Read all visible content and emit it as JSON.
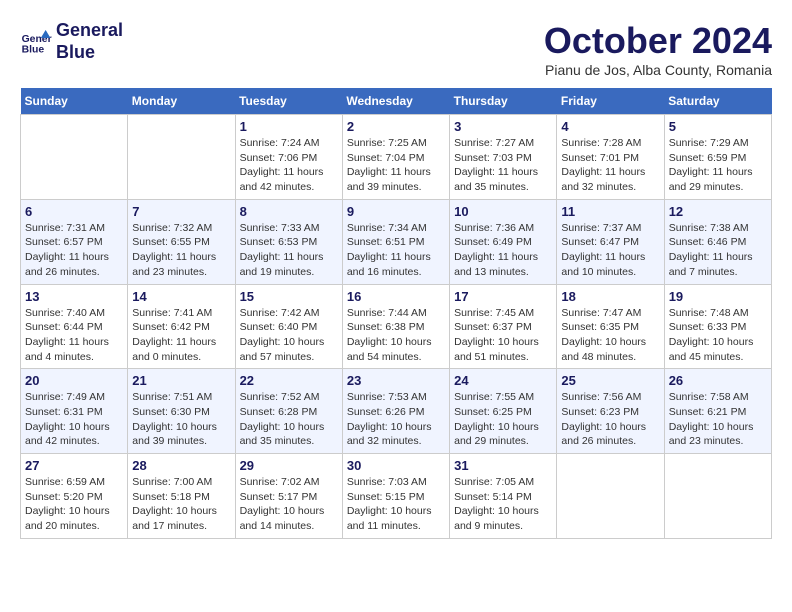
{
  "header": {
    "logo_line1": "General",
    "logo_line2": "Blue",
    "month": "October 2024",
    "location": "Pianu de Jos, Alba County, Romania"
  },
  "weekdays": [
    "Sunday",
    "Monday",
    "Tuesday",
    "Wednesday",
    "Thursday",
    "Friday",
    "Saturday"
  ],
  "weeks": [
    [
      {
        "day": "",
        "info": ""
      },
      {
        "day": "",
        "info": ""
      },
      {
        "day": "1",
        "info": "Sunrise: 7:24 AM\nSunset: 7:06 PM\nDaylight: 11 hours and 42 minutes."
      },
      {
        "day": "2",
        "info": "Sunrise: 7:25 AM\nSunset: 7:04 PM\nDaylight: 11 hours and 39 minutes."
      },
      {
        "day": "3",
        "info": "Sunrise: 7:27 AM\nSunset: 7:03 PM\nDaylight: 11 hours and 35 minutes."
      },
      {
        "day": "4",
        "info": "Sunrise: 7:28 AM\nSunset: 7:01 PM\nDaylight: 11 hours and 32 minutes."
      },
      {
        "day": "5",
        "info": "Sunrise: 7:29 AM\nSunset: 6:59 PM\nDaylight: 11 hours and 29 minutes."
      }
    ],
    [
      {
        "day": "6",
        "info": "Sunrise: 7:31 AM\nSunset: 6:57 PM\nDaylight: 11 hours and 26 minutes."
      },
      {
        "day": "7",
        "info": "Sunrise: 7:32 AM\nSunset: 6:55 PM\nDaylight: 11 hours and 23 minutes."
      },
      {
        "day": "8",
        "info": "Sunrise: 7:33 AM\nSunset: 6:53 PM\nDaylight: 11 hours and 19 minutes."
      },
      {
        "day": "9",
        "info": "Sunrise: 7:34 AM\nSunset: 6:51 PM\nDaylight: 11 hours and 16 minutes."
      },
      {
        "day": "10",
        "info": "Sunrise: 7:36 AM\nSunset: 6:49 PM\nDaylight: 11 hours and 13 minutes."
      },
      {
        "day": "11",
        "info": "Sunrise: 7:37 AM\nSunset: 6:47 PM\nDaylight: 11 hours and 10 minutes."
      },
      {
        "day": "12",
        "info": "Sunrise: 7:38 AM\nSunset: 6:46 PM\nDaylight: 11 hours and 7 minutes."
      }
    ],
    [
      {
        "day": "13",
        "info": "Sunrise: 7:40 AM\nSunset: 6:44 PM\nDaylight: 11 hours and 4 minutes."
      },
      {
        "day": "14",
        "info": "Sunrise: 7:41 AM\nSunset: 6:42 PM\nDaylight: 11 hours and 0 minutes."
      },
      {
        "day": "15",
        "info": "Sunrise: 7:42 AM\nSunset: 6:40 PM\nDaylight: 10 hours and 57 minutes."
      },
      {
        "day": "16",
        "info": "Sunrise: 7:44 AM\nSunset: 6:38 PM\nDaylight: 10 hours and 54 minutes."
      },
      {
        "day": "17",
        "info": "Sunrise: 7:45 AM\nSunset: 6:37 PM\nDaylight: 10 hours and 51 minutes."
      },
      {
        "day": "18",
        "info": "Sunrise: 7:47 AM\nSunset: 6:35 PM\nDaylight: 10 hours and 48 minutes."
      },
      {
        "day": "19",
        "info": "Sunrise: 7:48 AM\nSunset: 6:33 PM\nDaylight: 10 hours and 45 minutes."
      }
    ],
    [
      {
        "day": "20",
        "info": "Sunrise: 7:49 AM\nSunset: 6:31 PM\nDaylight: 10 hours and 42 minutes."
      },
      {
        "day": "21",
        "info": "Sunrise: 7:51 AM\nSunset: 6:30 PM\nDaylight: 10 hours and 39 minutes."
      },
      {
        "day": "22",
        "info": "Sunrise: 7:52 AM\nSunset: 6:28 PM\nDaylight: 10 hours and 35 minutes."
      },
      {
        "day": "23",
        "info": "Sunrise: 7:53 AM\nSunset: 6:26 PM\nDaylight: 10 hours and 32 minutes."
      },
      {
        "day": "24",
        "info": "Sunrise: 7:55 AM\nSunset: 6:25 PM\nDaylight: 10 hours and 29 minutes."
      },
      {
        "day": "25",
        "info": "Sunrise: 7:56 AM\nSunset: 6:23 PM\nDaylight: 10 hours and 26 minutes."
      },
      {
        "day": "26",
        "info": "Sunrise: 7:58 AM\nSunset: 6:21 PM\nDaylight: 10 hours and 23 minutes."
      }
    ],
    [
      {
        "day": "27",
        "info": "Sunrise: 6:59 AM\nSunset: 5:20 PM\nDaylight: 10 hours and 20 minutes."
      },
      {
        "day": "28",
        "info": "Sunrise: 7:00 AM\nSunset: 5:18 PM\nDaylight: 10 hours and 17 minutes."
      },
      {
        "day": "29",
        "info": "Sunrise: 7:02 AM\nSunset: 5:17 PM\nDaylight: 10 hours and 14 minutes."
      },
      {
        "day": "30",
        "info": "Sunrise: 7:03 AM\nSunset: 5:15 PM\nDaylight: 10 hours and 11 minutes."
      },
      {
        "day": "31",
        "info": "Sunrise: 7:05 AM\nSunset: 5:14 PM\nDaylight: 10 hours and 9 minutes."
      },
      {
        "day": "",
        "info": ""
      },
      {
        "day": "",
        "info": ""
      }
    ]
  ]
}
